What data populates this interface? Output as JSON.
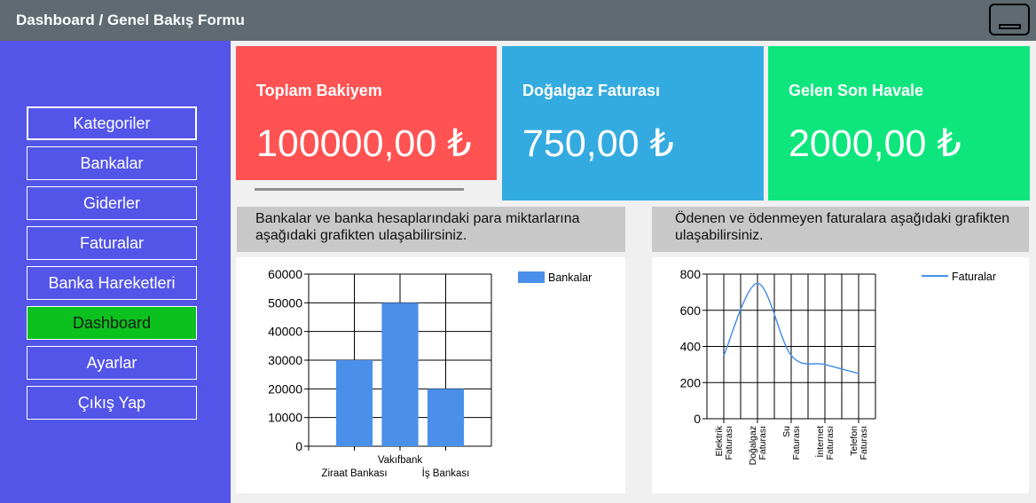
{
  "window": {
    "title": "Dashboard / Genel Bakış Formu",
    "minimize_icon": "minimize-icon"
  },
  "sidebar": {
    "items": [
      {
        "label": "Kategoriler"
      },
      {
        "label": "Bankalar"
      },
      {
        "label": "Giderler"
      },
      {
        "label": "Faturalar"
      },
      {
        "label": "Banka Hareketleri"
      },
      {
        "label": "Dashboard",
        "active": true
      },
      {
        "label": "Ayarlar"
      },
      {
        "label": "Çıkış Yap"
      }
    ]
  },
  "cards": [
    {
      "label": "Toplam Bakiyem",
      "value": "100000,00 ₺",
      "color": "#ff5252"
    },
    {
      "label": "Doğalgaz Faturası",
      "value": "750,00 ₺",
      "color": "#34abe0"
    },
    {
      "label": "Gelen Son Havale",
      "value": "2000,00 ₺",
      "color": "#0ee67d"
    }
  ],
  "banners": {
    "left": "Bankalar ve banka hesaplarındaki para miktarlarına aşağıdaki grafikten ulaşabilirsiniz.",
    "right": "Ödenen ve ödenmeyen faturalara aşağıdaki grafikten ulaşabilirsiniz."
  },
  "chart_data": [
    {
      "type": "bar",
      "categories": [
        "Ziraat Bankası",
        "Vakıfbank",
        "İş Bankası"
      ],
      "series": [
        {
          "name": "Bankalar",
          "values": [
            30000,
            50000,
            20000
          ],
          "color": "#4a90ea"
        }
      ],
      "y_ticks": [
        "0",
        "10000",
        "20000",
        "30000",
        "40000",
        "50000",
        "60000"
      ],
      "ylim": [
        0,
        60000
      ],
      "grid": true,
      "legend": "top-right"
    },
    {
      "type": "line",
      "categories": [
        "Elektrik Faturası",
        "Doğalgaz Faturası",
        "Su Faturası",
        "İnternet Faturası",
        "Telefon Faturası"
      ],
      "series": [
        {
          "name": "Faturalar",
          "values": [
            350,
            750,
            350,
            300,
            250
          ],
          "color": "#4a90ea"
        }
      ],
      "y_ticks": [
        "0",
        "200",
        "400",
        "600",
        "800"
      ],
      "ylim": [
        0,
        800
      ],
      "grid": true,
      "legend": "top-right"
    }
  ]
}
